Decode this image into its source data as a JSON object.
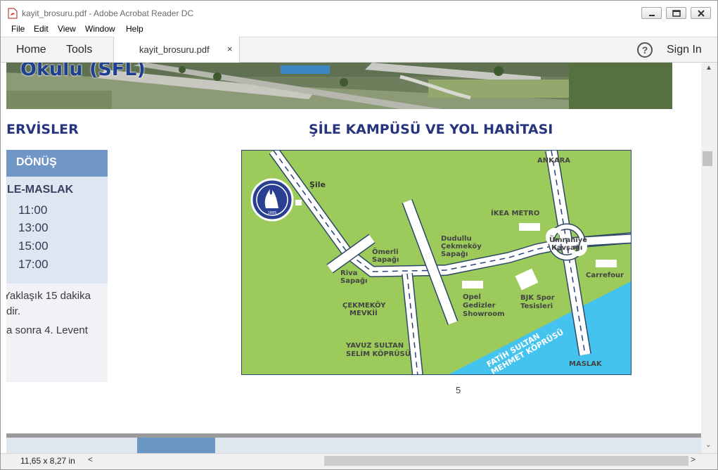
{
  "window": {
    "title": "kayit_brosuru.pdf - Adobe Acrobat Reader DC"
  },
  "menu": {
    "items": [
      "File",
      "Edit",
      "View",
      "Window",
      "Help"
    ]
  },
  "toolbar": {
    "home_label": "Home",
    "tools_label": "Tools",
    "tab_label": "kayit_brosuru.pdf",
    "tab_close": "×",
    "help_glyph": "?",
    "sign_in_label": "Sign In"
  },
  "document": {
    "photo_caption": "Okulu (SFL)",
    "left_heading": "ERVİSLER",
    "map_heading": "ŞİLE KAMPÜSÜ VE YOL HARİTASI",
    "schedule": {
      "header": "DÖNÜŞ",
      "route": "LE-MASLAK",
      "times": [
        "11:00",
        "13:00",
        "15:00",
        "17:00"
      ]
    },
    "note_lines": [
      "Yaklaşık 15 dakika",
      "dir.",
      "a sonra 4. Levent"
    ],
    "page_number": "5",
    "map": {
      "labels": {
        "sile": "Şile",
        "ankara": "ANKARA",
        "ikea": "İKEA METRO",
        "dudullu": [
          "Dudullu",
          "Çekmeköy",
          "Sapağı"
        ],
        "omerli": [
          "Ömerli",
          "Sapağı"
        ],
        "riva": [
          "Riva",
          "Sapağı"
        ],
        "umraniye": [
          "Ümraniye",
          "Kavşağı"
        ],
        "carrefour": "Carrefour",
        "opel": [
          "Opel",
          "Gedizler",
          "Showroom"
        ],
        "bjk": [
          "BJK Spor",
          "Tesisleri"
        ],
        "cekmekoy": [
          "ÇEKMEKÖY",
          "MEVKİİ"
        ],
        "yavuz": [
          "YAVUZ SULTAN",
          "SELİM KÖPRÜSÜ"
        ],
        "fatih": [
          "FATİH SULTAN",
          "MEHMET KÖPRÜSÜ"
        ],
        "maslak": "MASLAK",
        "logo_year": "1885"
      }
    }
  },
  "status": {
    "page_size": "11,65 x 8,27 in",
    "scroll_left": "<",
    "scroll_right": ">",
    "scroll_up": "▲",
    "scroll_down": "⌄"
  },
  "colors": {
    "heading": "#27357f",
    "schedule_header": "#6f96c5",
    "map_green": "#9ccb5b",
    "map_water": "#45c3ef"
  }
}
